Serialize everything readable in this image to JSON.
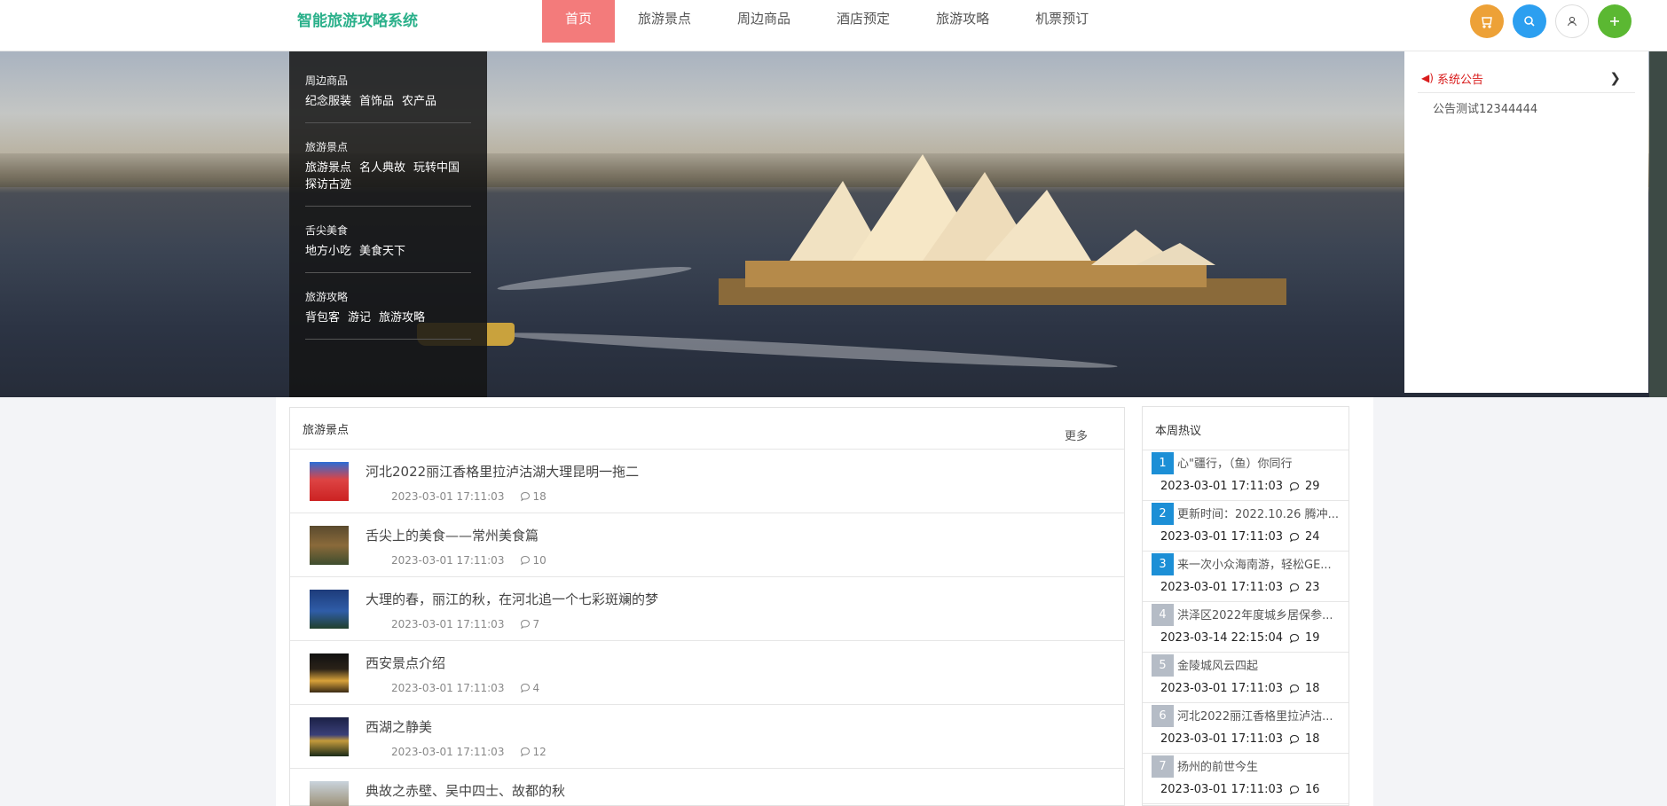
{
  "header": {
    "logo": "智能旅游攻略系统",
    "nav": [
      "首页",
      "旅游景点",
      "周边商品",
      "酒店预定",
      "旅游攻略",
      "机票预订"
    ],
    "active_nav": "首页",
    "buttons": [
      {
        "icon": "cart-icon",
        "color": "#f0a030"
      },
      {
        "icon": "search-icon",
        "color": "#2c9ff0"
      },
      {
        "icon": "user-icon",
        "color": "#ffffff"
      },
      {
        "icon": "plus-icon",
        "color": "#5bb832"
      }
    ]
  },
  "category_menu": [
    {
      "title": "周边商品",
      "links": [
        "纪念服装",
        "首饰品",
        "农产品"
      ]
    },
    {
      "title": "旅游景点",
      "links": [
        "旅游景点",
        "名人典故",
        "玩转中国",
        "探访古迹"
      ]
    },
    {
      "title": "舌尖美食",
      "links": [
        "地方小吃",
        "美食天下"
      ]
    },
    {
      "title": "旅游攻略",
      "links": [
        "背包客",
        "游记",
        "旅游攻略"
      ]
    }
  ],
  "notice": {
    "title": "系统公告",
    "items": [
      "公告测试12344444"
    ]
  },
  "attractions": {
    "title": "旅游景点",
    "more": "更多",
    "items": [
      {
        "title": "河北2022丽江香格里拉泸沽湖大理昆明一拖二",
        "date": "2023-03-01 17:11:03",
        "comments": "18"
      },
      {
        "title": "舌尖上的美食——常州美食篇",
        "date": "2023-03-01 17:11:03",
        "comments": "10"
      },
      {
        "title": "大理的春，丽江的秋，在河北追一个七彩斑斓的梦",
        "date": "2023-03-01 17:11:03",
        "comments": "7"
      },
      {
        "title": "西安景点介绍",
        "date": "2023-03-01 17:11:03",
        "comments": "4"
      },
      {
        "title": "西湖之静美",
        "date": "2023-03-01 17:11:03",
        "comments": "12"
      },
      {
        "title": "典故之赤壁、吴中四士、故都的秋",
        "date": "",
        "comments": ""
      }
    ]
  },
  "hot": {
    "title": "本周热议",
    "items": [
      {
        "rank": "1",
        "title": "心\"疆行，（鱼）你同行",
        "date": "2023-03-01 17:11:03",
        "comments": "29"
      },
      {
        "rank": "2",
        "title": "更新时间：2022.10.26 腾冲...",
        "date": "2023-03-01 17:11:03",
        "comments": "24"
      },
      {
        "rank": "3",
        "title": "来一次小众海南游，轻松GE...",
        "date": "2023-03-01 17:11:03",
        "comments": "23"
      },
      {
        "rank": "4",
        "title": "洪泽区2022年度城乡居保参...",
        "date": "2023-03-14 22:15:04",
        "comments": "19"
      },
      {
        "rank": "5",
        "title": "金陵城风云四起",
        "date": "2023-03-01 17:11:03",
        "comments": "18"
      },
      {
        "rank": "6",
        "title": "河北2022丽江香格里拉泸沽...",
        "date": "2023-03-01 17:11:03",
        "comments": "18"
      },
      {
        "rank": "7",
        "title": "扬州的前世今生",
        "date": "2023-03-01 17:11:03",
        "comments": "16"
      }
    ]
  }
}
